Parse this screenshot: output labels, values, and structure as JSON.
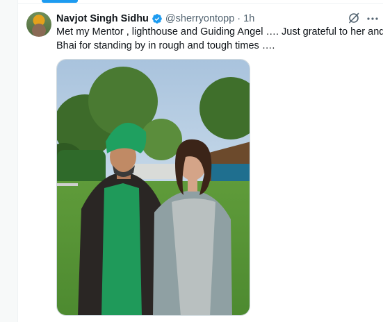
{
  "tweet": {
    "author_name": "Navjot Singh Sidhu",
    "handle": "@sherryontopp",
    "separator": "·",
    "time": "1h",
    "text_line1": "Met my Mentor , lighthouse and Guiding Angel …. Just grateful to her and",
    "text_line2": "Bhai for standing by in rough and tough times …."
  },
  "icons": {
    "verified": "verified-badge-icon",
    "grok": "grok-slash-icon",
    "more": "more-icon"
  },
  "colors": {
    "accent": "#1d9bf0",
    "text_primary": "#0f1419",
    "text_secondary": "#536471"
  }
}
